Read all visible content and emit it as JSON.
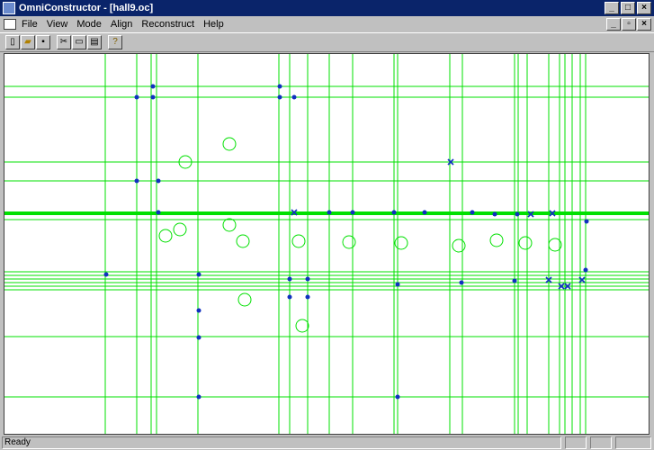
{
  "window": {
    "title": "OmniConstructor - [hall9.oc]"
  },
  "menu": {
    "items": [
      "File",
      "View",
      "Mode",
      "Align",
      "Reconstruct",
      "Help"
    ]
  },
  "status": {
    "text": "Ready"
  },
  "colors": {
    "lines": "#00e000",
    "points": "#1030c0",
    "canvas": "#ffffff"
  },
  "toolbar": {
    "icons": [
      "new-icon",
      "open-icon",
      "save-icon",
      "cut-icon",
      "copy-icon",
      "paste-icon",
      "help-icon"
    ]
  }
}
